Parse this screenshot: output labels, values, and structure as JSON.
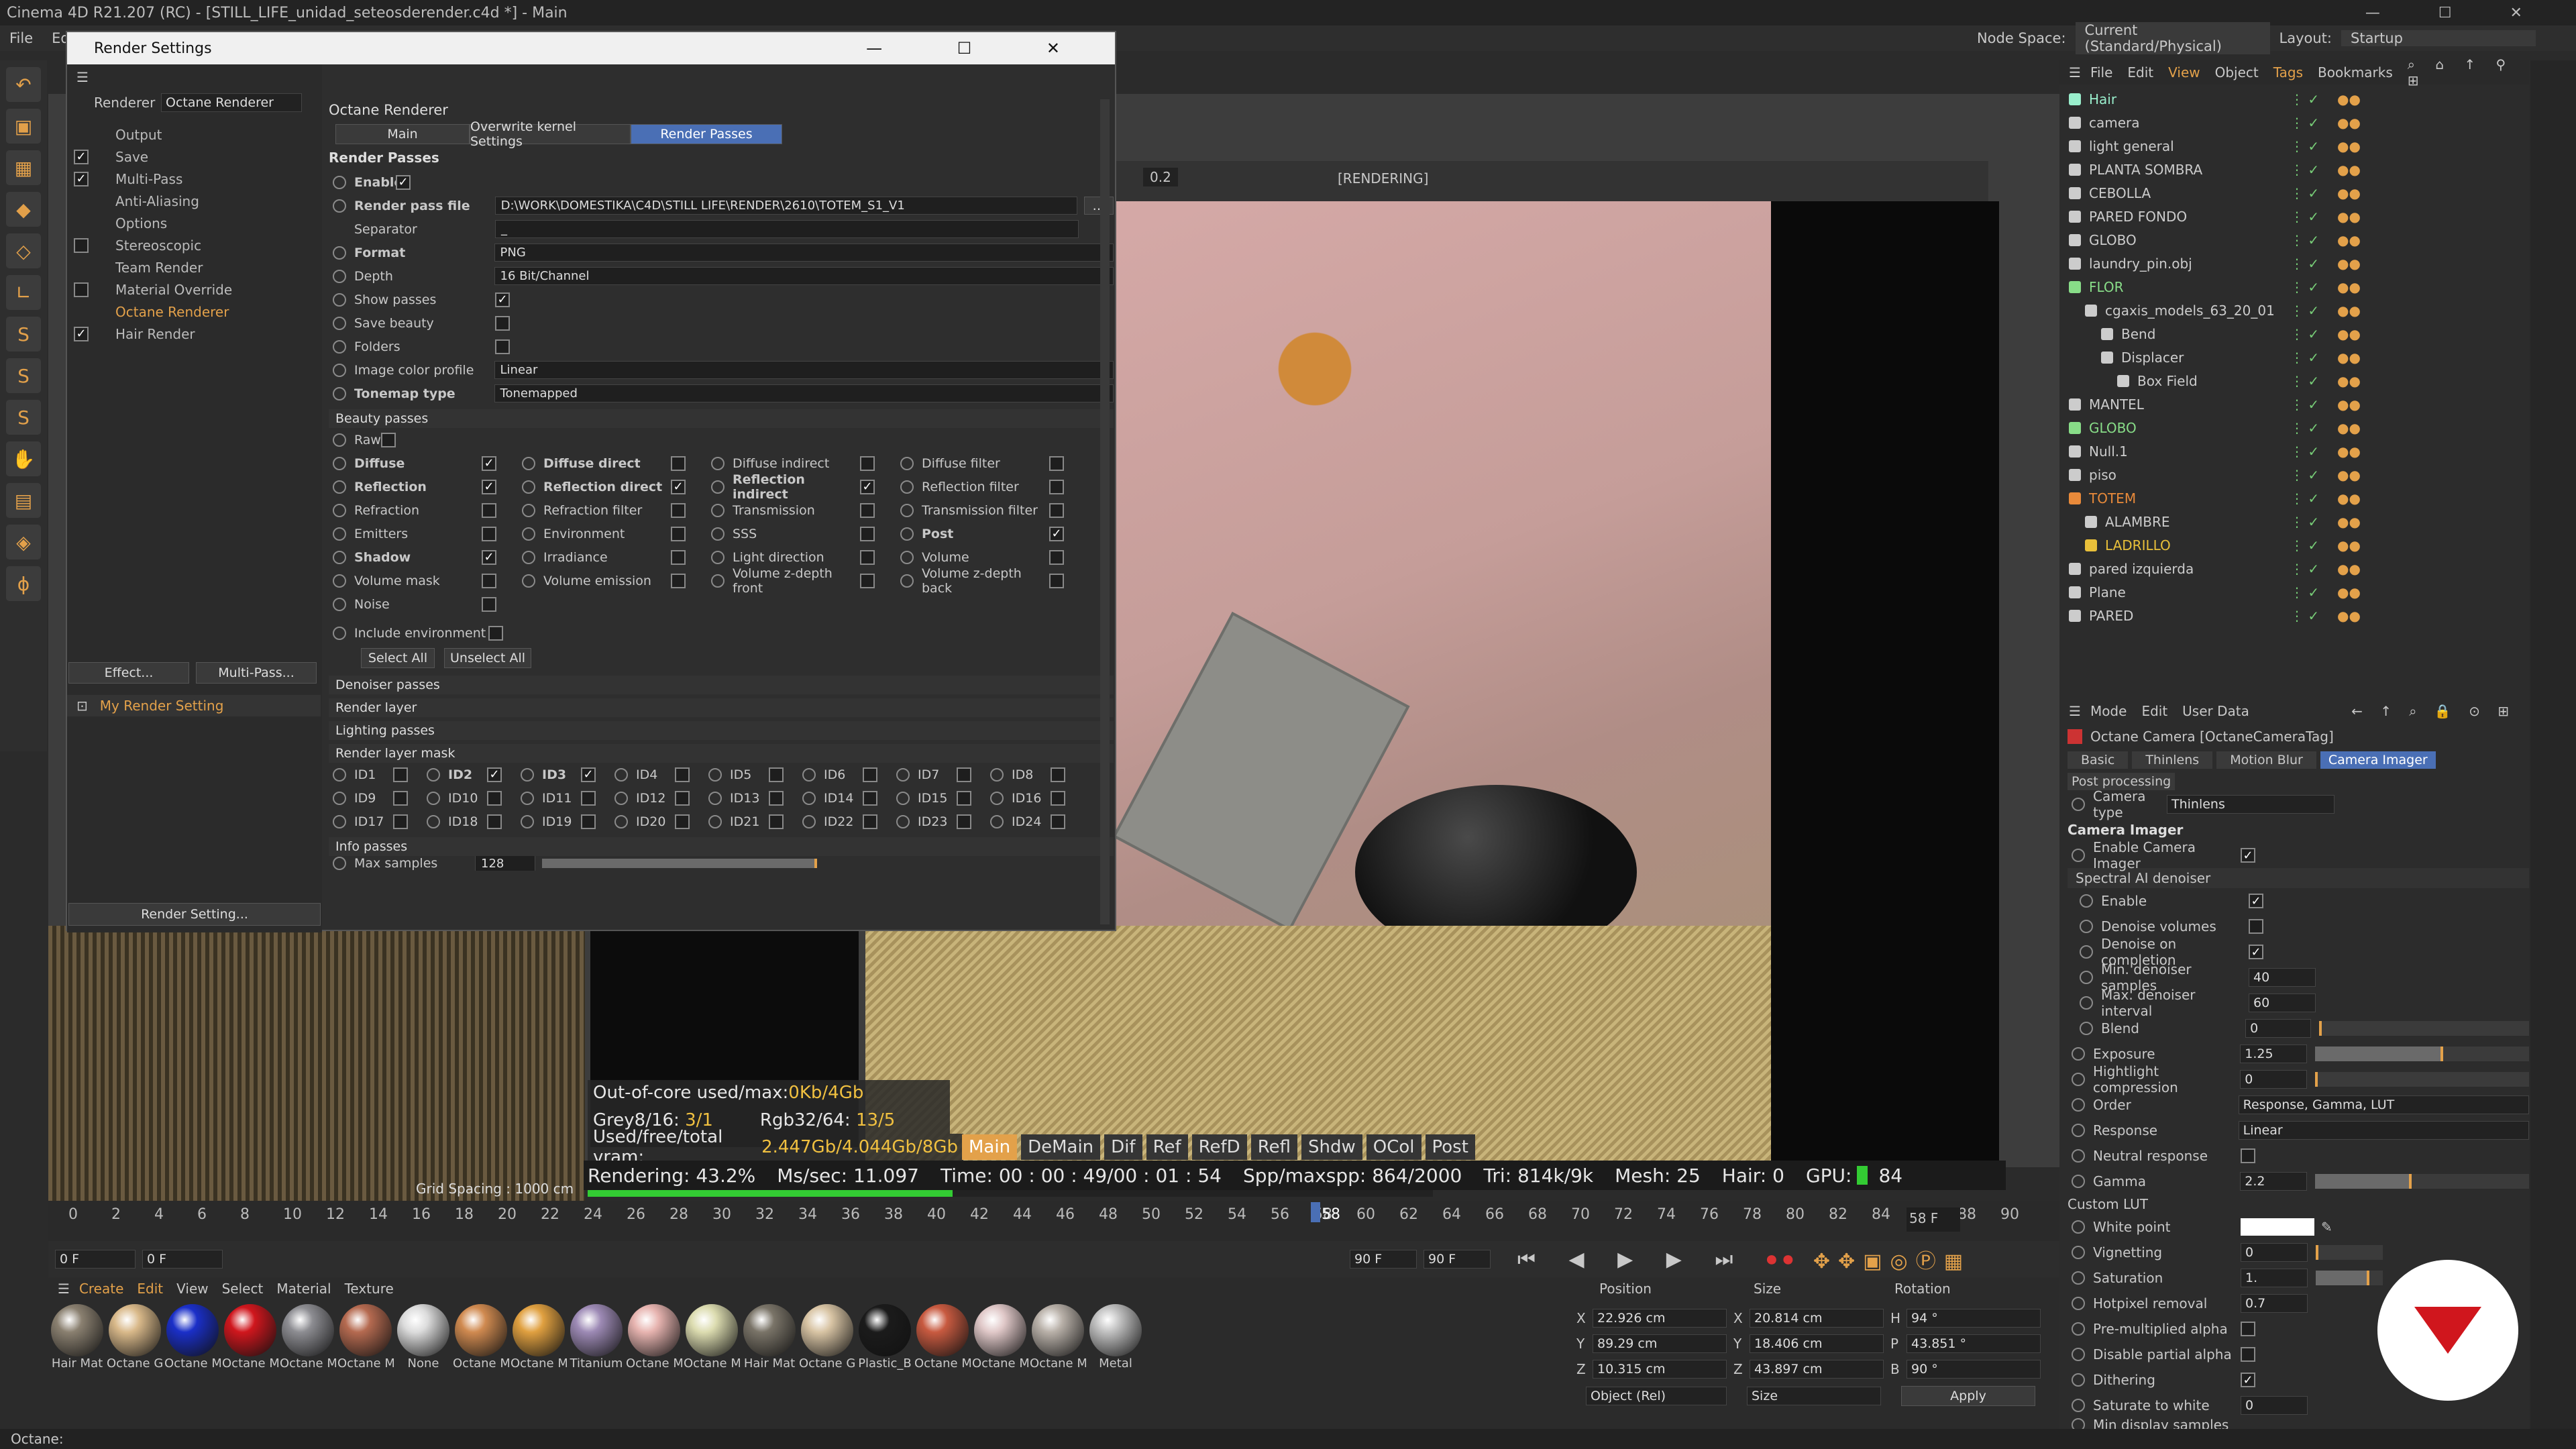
{
  "window": {
    "title": "Cinema 4D R21.207 (RC) - [STILL_LIFE_unidad_seteosderender.c4d *] - Main"
  },
  "menubar": {
    "items": [
      "File",
      "Edit"
    ],
    "node_space_label": "Node Space:",
    "node_space_value": "Current (Standard/Physical)",
    "layout_label": "Layout:",
    "layout_value": "Startup"
  },
  "viewport": {
    "rendering_label": "[RENDERING]",
    "zoom_value": "0.2",
    "grid_spacing": "Grid Spacing : 1000 cm"
  },
  "render_stats": {
    "ooc_label": "Out-of-core used/max:",
    "ooc_value": "0Kb/4Gb",
    "grey_label": "Grey8/16:",
    "grey_value": "3/1",
    "rgb_label": "Rgb32/64:",
    "rgb_value": "13/5",
    "vram_label": "Used/free/total vram:",
    "vram_value": "2.447Gb/4.044Gb/8Gb"
  },
  "pass_tabs": [
    "Main",
    "DeMain",
    "Dif",
    "Ref",
    "RefD",
    "Refl",
    "Shdw",
    "OCol",
    "Post"
  ],
  "status_line": {
    "rendering": "Rendering: 43.2%",
    "mssec": "Ms/sec: 11.097",
    "time": "Time: 00 : 00 : 49/00 : 01 : 54",
    "spp": "Spp/maxspp: 864/2000",
    "tri": "Tri: 814k/9k",
    "mesh": "Mesh: 25",
    "hair": "Hair: 0",
    "gpu": "GPU:",
    "gpu_temp": "84",
    "progress": 0.432
  },
  "timeline": {
    "ticks": [
      "0",
      "2",
      "4",
      "6",
      "8",
      "10",
      "12",
      "14",
      "16",
      "18",
      "20",
      "22",
      "24",
      "26",
      "28",
      "30",
      "32",
      "34",
      "36",
      "38",
      "40",
      "42",
      "44",
      "46",
      "48",
      "50",
      "52",
      "54",
      "56",
      "58",
      "60",
      "62",
      "64",
      "66",
      "68",
      "70",
      "72",
      "74",
      "76",
      "78",
      "80",
      "82",
      "84",
      "86",
      "88",
      "90"
    ],
    "current_frame": "58",
    "frame_end": "58 F",
    "start": "0 F",
    "start2": "0 F",
    "end": "90 F",
    "end2": "90 F"
  },
  "material_panel": {
    "menu": [
      "Create",
      "Edit",
      "View",
      "Select",
      "Material",
      "Texture"
    ],
    "materials": [
      {
        "name": "Hair Mat",
        "color": "#8a8070"
      },
      {
        "name": "Octane G",
        "color": "#d9b98a"
      },
      {
        "name": "Octane M",
        "color": "#1a2fc8"
      },
      {
        "name": "Octane M",
        "color": "#d0161d"
      },
      {
        "name": "Octane M",
        "color": "#8d8d92"
      },
      {
        "name": "Octane M",
        "color": "#b56a50"
      },
      {
        "name": "None",
        "color": "#dcdcdc"
      },
      {
        "name": "Octane M",
        "color": "#d08a50"
      },
      {
        "name": "Octane M",
        "color": "#e0a040"
      },
      {
        "name": "Titanium",
        "color": "#9d8ab5"
      },
      {
        "name": "Octane M",
        "color": "#e7b4b0"
      },
      {
        "name": "Octane M",
        "color": "#dcdcb0"
      },
      {
        "name": "Hair Mat",
        "color": "#7a7468"
      },
      {
        "name": "Octane G",
        "color": "#d8c4a4"
      },
      {
        "name": "Plastic_B",
        "color": "#1b1b1b"
      },
      {
        "name": "Octane M",
        "color": "#c85a40"
      },
      {
        "name": "Octane M",
        "color": "#e0c8c8"
      },
      {
        "name": "Octane M",
        "color": "#b8b0a8"
      },
      {
        "name": "Metal",
        "color": "#c0c0c0"
      }
    ]
  },
  "coords": {
    "headers": [
      "Position",
      "Size",
      "Rotation"
    ],
    "rows": [
      [
        "X",
        "22.926 cm",
        "X",
        "20.814 cm",
        "H",
        "94 °"
      ],
      [
        "Y",
        "89.29 cm",
        "Y",
        "18.406 cm",
        "P",
        "43.851 °"
      ],
      [
        "Z",
        "10.315 cm",
        "Z",
        "43.897 cm",
        "B",
        "90 °"
      ]
    ],
    "mode": "Object (Rel)",
    "size_mode": "Size",
    "apply": "Apply"
  },
  "objects": {
    "menu": [
      "File",
      "Edit",
      "View",
      "Object",
      "Tags",
      "Bookmarks"
    ],
    "items": [
      {
        "name": "Hair",
        "indent": 0,
        "color": "#9ec"
      },
      {
        "name": "camera",
        "indent": 0,
        "color": "#ccc"
      },
      {
        "name": "light general",
        "indent": 0,
        "color": "#ccc"
      },
      {
        "name": "PLANTA SOMBRA",
        "indent": 0,
        "color": "#ccc"
      },
      {
        "name": "CEBOLLA",
        "indent": 0,
        "color": "#ccc"
      },
      {
        "name": "PARED FONDO",
        "indent": 0,
        "color": "#ccc"
      },
      {
        "name": "GLOBO",
        "indent": 0,
        "color": "#ccc"
      },
      {
        "name": "laundry_pin.obj",
        "indent": 0,
        "color": "#ccc"
      },
      {
        "name": "FLOR",
        "indent": 0,
        "color": "#8d8"
      },
      {
        "name": "cgaxis_models_63_20_01",
        "indent": 1,
        "color": "#ccc"
      },
      {
        "name": "Bend",
        "indent": 2,
        "color": "#ccc"
      },
      {
        "name": "Displacer",
        "indent": 2,
        "color": "#ccc"
      },
      {
        "name": "Box Field",
        "indent": 3,
        "color": "#ccc"
      },
      {
        "name": "MANTEL",
        "indent": 0,
        "color": "#ccc"
      },
      {
        "name": "GLOBO",
        "indent": 0,
        "color": "#8d8"
      },
      {
        "name": "Null.1",
        "indent": 0,
        "color": "#ccc"
      },
      {
        "name": "piso",
        "indent": 0,
        "color": "#ccc"
      },
      {
        "name": "TOTEM",
        "indent": 0,
        "color": "#e98a3a"
      },
      {
        "name": "ALAMBRE",
        "indent": 1,
        "color": "#ccc"
      },
      {
        "name": "LADRILLO",
        "indent": 1,
        "color": "#e9c03a"
      },
      {
        "name": "pared izquierda",
        "indent": 0,
        "color": "#ccc"
      },
      {
        "name": "Plane",
        "indent": 0,
        "color": "#ccc"
      },
      {
        "name": "PARED",
        "indent": 0,
        "color": "#ccc"
      }
    ]
  },
  "attributes": {
    "menu": [
      "Mode",
      "Edit",
      "User Data"
    ],
    "title": "Octane Camera [OctaneCameraTag]",
    "tabs": [
      "Basic",
      "Thinlens",
      "Motion Blur",
      "Camera Imager"
    ],
    "tab2": "Post processing",
    "camera_type_label": "Camera type",
    "camera_type_value": "Thinlens",
    "section": "Camera Imager",
    "enable_imager": "Enable Camera Imager",
    "denoiser_header": "Spectral AI denoiser",
    "denoiser": [
      {
        "label": "Enable",
        "checked": true
      },
      {
        "label": "Denoise volumes",
        "checked": false
      },
      {
        "label": "Denoise on completion",
        "checked": true
      }
    ],
    "min_samples_label": "Min. denoiser samples",
    "min_samples": "40",
    "max_interval_label": "Max. denoiser interval",
    "max_interval": "60",
    "blend_label": "Blend",
    "blend": "0",
    "exposure_label": "Exposure",
    "exposure": "1.25",
    "highlight_label": "Hightlight compression",
    "highlight": "0",
    "order_label": "Order",
    "order": "Response, Gamma, LUT",
    "response_label": "Response",
    "response": "Linear",
    "neutral_label": "Neutral response",
    "gamma_label": "Gamma",
    "gamma": "2.2",
    "custom_lut": "Custom LUT",
    "white_point": "White point",
    "vignetting_label": "Vignetting",
    "vignetting": "0",
    "saturation_label": "Saturation",
    "saturation": "1.",
    "hotpixel_label": "Hotpixel removal",
    "hotpixel": "0.7",
    "premult": "Pre-multiplied alpha",
    "disable_partial": "Disable partial alpha",
    "dithering": "Dithering",
    "saturate_white_label": "Saturate to white",
    "saturate_white": "0",
    "min_display": "Min display samples"
  },
  "dialog": {
    "title": "Render Settings",
    "renderer_label": "Renderer",
    "renderer_value": "Octane Renderer",
    "sidebar": [
      {
        "label": "Output",
        "check": null,
        "color": "#bbb"
      },
      {
        "label": "Save",
        "check": true,
        "color": "#bbb"
      },
      {
        "label": "Multi-Pass",
        "check": true,
        "color": "#bbb"
      },
      {
        "label": "Anti-Aliasing",
        "check": null,
        "color": "#bbb"
      },
      {
        "label": "Options",
        "check": null,
        "color": "#bbb"
      },
      {
        "label": "Stereoscopic",
        "check": false,
        "color": "#bbb"
      },
      {
        "label": "Team Render",
        "check": null,
        "color": "#bbb"
      },
      {
        "label": "Material Override",
        "check": false,
        "color": "#bbb"
      },
      {
        "label": "Octane Renderer",
        "check": null,
        "color": "#e3a14a"
      },
      {
        "label": "Hair Render",
        "check": true,
        "color": "#bbb"
      }
    ],
    "effect_btn": "Effect...",
    "multipass_btn": "Multi-Pass...",
    "my_setting": "My Render Setting",
    "render_setting_btn": "Render Setting...",
    "header": "Octane Renderer",
    "tabs": [
      "Main",
      "Overwrite kernel Settings",
      "Render Passes"
    ],
    "section": "Render Passes",
    "enable_label": "Enable",
    "pass_file_label": "Render pass file",
    "pass_file_value": "D:\\WORK\\DOMESTIKA\\C4D\\STILL LIFE\\RENDER\\2610\\TOTEM_S1_V1",
    "separator_label": "Separator",
    "separator_value": "_",
    "format_label": "Format",
    "format_value": "PNG",
    "depth_label": "Depth",
    "depth_value": "16 Bit/Channel",
    "show_passes": "Show passes",
    "save_beauty": "Save beauty",
    "folders": "Folders",
    "color_profile_label": "Image color profile",
    "color_profile_value": "Linear",
    "tonemap_label": "Tonemap type",
    "tonemap_value": "Tonemapped",
    "beauty_header": "Beauty passes",
    "raw": "Raw",
    "beauty_rows": [
      [
        {
          "l": "Diffuse",
          "c": true,
          "b": true
        },
        {
          "l": "Diffuse direct",
          "c": false,
          "b": true
        },
        {
          "l": "Diffuse indirect",
          "c": false,
          "b": false
        },
        {
          "l": "Diffuse filter",
          "c": false,
          "b": false
        }
      ],
      [
        {
          "l": "Reflection",
          "c": true,
          "b": true
        },
        {
          "l": "Reflection direct",
          "c": true,
          "b": true
        },
        {
          "l": "Reflection indirect",
          "c": true,
          "b": true
        },
        {
          "l": "Reflection filter",
          "c": false,
          "b": false
        }
      ],
      [
        {
          "l": "Refraction",
          "c": false,
          "b": false
        },
        {
          "l": "Refraction filter",
          "c": false,
          "b": false
        },
        {
          "l": "Transmission",
          "c": false,
          "b": false
        },
        {
          "l": "Transmission filter",
          "c": false,
          "b": false
        }
      ],
      [
        {
          "l": "Emitters",
          "c": false,
          "b": false
        },
        {
          "l": "Environment",
          "c": false,
          "b": false
        },
        {
          "l": "SSS",
          "c": false,
          "b": false
        },
        {
          "l": "Post",
          "c": true,
          "b": true
        }
      ],
      [
        {
          "l": "Shadow",
          "c": true,
          "b": true
        },
        {
          "l": "Irradiance",
          "c": false,
          "b": false
        },
        {
          "l": "Light direction",
          "c": false,
          "b": false
        },
        {
          "l": "Volume",
          "c": false,
          "b": false
        }
      ],
      [
        {
          "l": "Volume mask",
          "c": false,
          "b": false
        },
        {
          "l": "Volume emission",
          "c": false,
          "b": false
        },
        {
          "l": "Volume z-depth front",
          "c": false,
          "b": false
        },
        {
          "l": "Volume z-depth back",
          "c": false,
          "b": false
        }
      ],
      [
        {
          "l": "Noise",
          "c": false,
          "b": false
        }
      ]
    ],
    "include_env": "Include environment",
    "select_all": "Select All",
    "unselect_all": "Unselect All",
    "collapsed": [
      "Denoiser passes",
      "Render layer",
      "Lighting passes"
    ],
    "layer_mask_header": "Render layer mask",
    "ids": [
      [
        "ID1",
        "ID2",
        "ID3",
        "ID4",
        "ID5",
        "ID6",
        "ID7",
        "ID8"
      ],
      [
        "ID9",
        "ID10",
        "ID11",
        "ID12",
        "ID13",
        "ID14",
        "ID15",
        "ID16"
      ],
      [
        "ID17",
        "ID18",
        "ID19",
        "ID20",
        "ID21",
        "ID22",
        "ID23",
        "ID24"
      ]
    ],
    "ids_checked": [
      "ID2",
      "ID3"
    ],
    "info_header": "Info passes",
    "max_samples_label": "Max samples",
    "max_samples": "128"
  },
  "bottom": {
    "status": "Octane:"
  },
  "colors": {
    "accent": "#e3a14a",
    "selected_tab": "#4a6fb5",
    "brand": "#d0161d"
  }
}
